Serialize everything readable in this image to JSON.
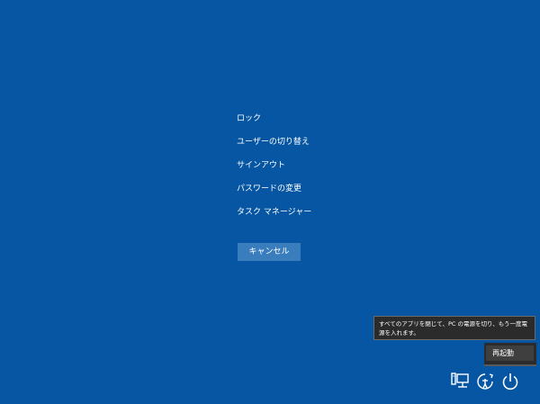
{
  "menu": {
    "items": [
      {
        "label": "ロック"
      },
      {
        "label": "ユーザーの切り替え"
      },
      {
        "label": "サインアウト"
      },
      {
        "label": "パスワードの変更"
      },
      {
        "label": "タスク マネージャー"
      }
    ]
  },
  "cancel": {
    "label": "キャンセル"
  },
  "tooltip": {
    "text": "すべてのアプリを閉じて、PC の電源を切り、もう一度電源を入れます。"
  },
  "power_menu": {
    "items": [
      {
        "label": "再起動"
      }
    ]
  },
  "icons": {
    "network": "network-icon",
    "accessibility": "ease-of-access-icon",
    "power": "power-icon"
  },
  "colors": {
    "background": "#0656a3",
    "button": "#3a7dbd",
    "tooltip": "#2b2b2b"
  }
}
